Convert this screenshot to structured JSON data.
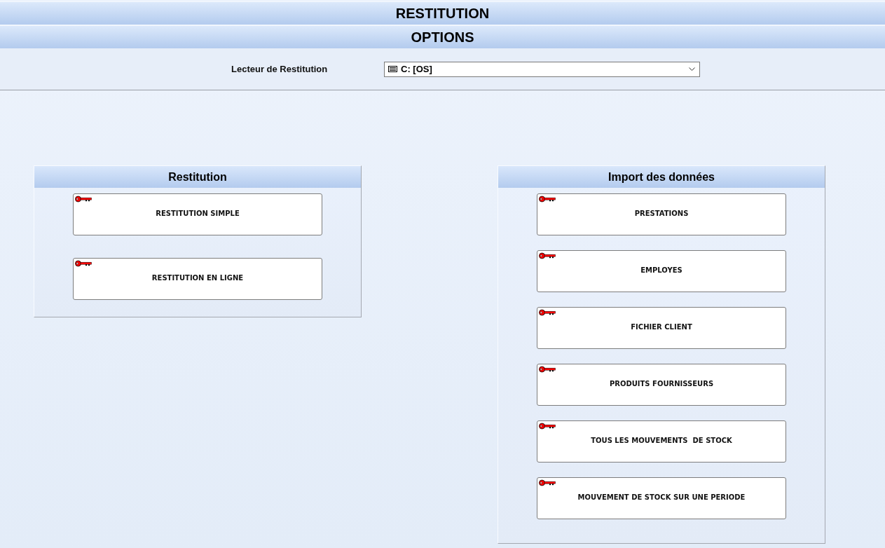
{
  "title_bar": {
    "title": "RESTITUTION"
  },
  "options_bar": {
    "title": "OPTIONS"
  },
  "drive_selector": {
    "label": "Lecteur de Restitution",
    "value": "C: [OS]"
  },
  "panels": [
    {
      "title": "Restitution",
      "buttons": [
        "RESTITUTION SIMPLE",
        "RESTITUTION EN LIGNE"
      ]
    },
    {
      "title": "Import des données",
      "buttons": [
        "PRESTATIONS",
        "EMPLOYES",
        "FICHIER CLIENT",
        "PRODUITS FOURNISSEURS",
        "TOUS LES MOUVEMENTS  DE STOCK",
        "MOUVEMENT DE STOCK SUR UNE PERIODE"
      ]
    }
  ]
}
